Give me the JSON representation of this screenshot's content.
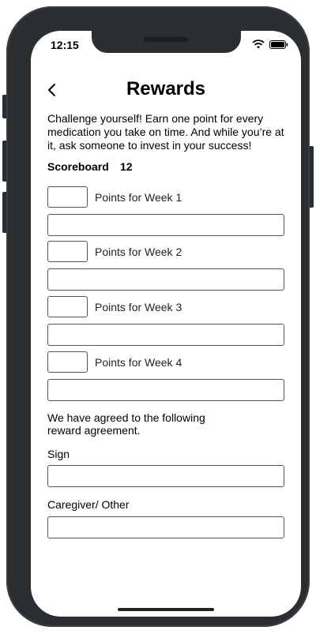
{
  "status": {
    "time": "12:15"
  },
  "header": {
    "title": "Rewards"
  },
  "intro": {
    "text": "Challenge yourself! Earn one point for every medication you take on time. And while you’re at it, ask someone to invest in your success!"
  },
  "scoreboard": {
    "label": "Scoreboard",
    "value": "12"
  },
  "weeks": [
    {
      "label": "Points for Week 1"
    },
    {
      "label": "Points for Week 2"
    },
    {
      "label": "Points for Week 3"
    },
    {
      "label": "Points for Week 4"
    }
  ],
  "agreement": {
    "text": "We have agreed to the following reward agreement."
  },
  "sign": {
    "label": "Sign"
  },
  "caregiver": {
    "label": "Caregiver/ Other"
  },
  "colors": {
    "frame": "#2a2e31",
    "border": "#555555"
  },
  "icons": {
    "back": "chevron-left-icon",
    "wifi": "wifi-icon",
    "battery": "battery-icon"
  }
}
